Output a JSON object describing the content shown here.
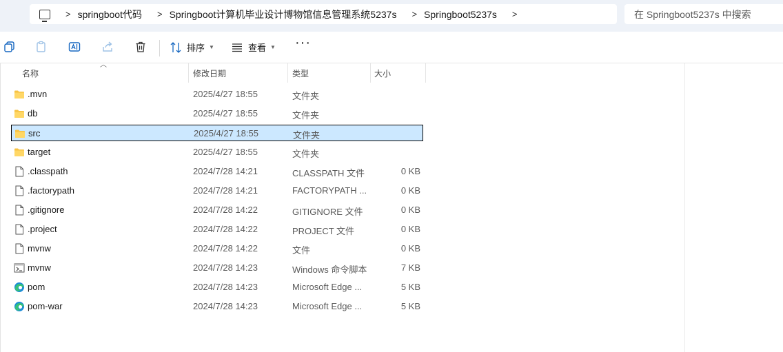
{
  "address_bar": {
    "breadcrumbs": [
      "springboot代码",
      "Springboot计算机毕业设计博物馆信息管理系统5237s",
      "Springboot5237s"
    ],
    "separator": ">"
  },
  "search": {
    "placeholder": "在 Springboot5237s 中搜索"
  },
  "toolbar": {
    "icons": [
      "copy-icon",
      "paste-icon",
      "rename-icon",
      "share-icon",
      "delete-icon"
    ],
    "sort_label": "排序",
    "view_label": "查看",
    "more_label": "···"
  },
  "columns": {
    "name": "名称",
    "date": "修改日期",
    "type": "类型",
    "size": "大小"
  },
  "files": [
    {
      "name": ".mvn",
      "date": "2025/4/27 18:55",
      "type": "文件夹",
      "size": "",
      "icon": "folder-icon"
    },
    {
      "name": "db",
      "date": "2025/4/27 18:55",
      "type": "文件夹",
      "size": "",
      "icon": "folder-icon"
    },
    {
      "name": "src",
      "date": "2025/4/27 18:55",
      "type": "文件夹",
      "size": "",
      "icon": "folder-icon",
      "selected": true
    },
    {
      "name": "target",
      "date": "2025/4/27 18:55",
      "type": "文件夹",
      "size": "",
      "icon": "folder-icon"
    },
    {
      "name": ".classpath",
      "date": "2024/7/28 14:21",
      "type": "CLASSPATH 文件",
      "size": "0 KB",
      "icon": "file-icon"
    },
    {
      "name": ".factorypath",
      "date": "2024/7/28 14:21",
      "type": "FACTORYPATH ...",
      "size": "0 KB",
      "icon": "file-icon"
    },
    {
      "name": ".gitignore",
      "date": "2024/7/28 14:22",
      "type": "GITIGNORE 文件",
      "size": "0 KB",
      "icon": "file-icon"
    },
    {
      "name": ".project",
      "date": "2024/7/28 14:22",
      "type": "PROJECT 文件",
      "size": "0 KB",
      "icon": "file-icon"
    },
    {
      "name": "mvnw",
      "date": "2024/7/28 14:22",
      "type": "文件",
      "size": "0 KB",
      "icon": "file-icon"
    },
    {
      "name": "mvnw",
      "date": "2024/7/28 14:23",
      "type": "Windows 命令脚本",
      "size": "7 KB",
      "icon": "script-icon"
    },
    {
      "name": "pom",
      "date": "2024/7/28 14:23",
      "type": "Microsoft Edge ...",
      "size": "5 KB",
      "icon": "edge-icon"
    },
    {
      "name": "pom-war",
      "date": "2024/7/28 14:23",
      "type": "Microsoft Edge ...",
      "size": "5 KB",
      "icon": "edge-icon"
    }
  ],
  "colors": {
    "selection": "#cce8ff",
    "accent": "#1566c0",
    "folder": "#f7c242"
  }
}
